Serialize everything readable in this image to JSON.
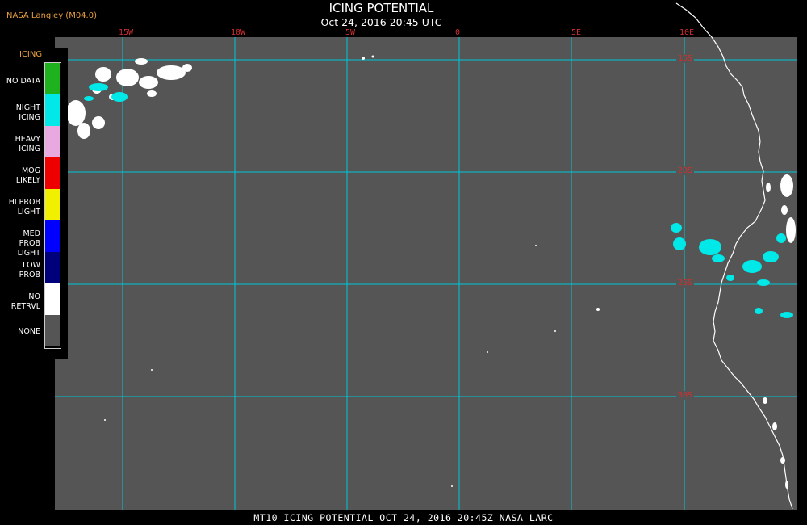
{
  "header": {
    "credit": "NASA Langley (M04.0)",
    "title": "ICING POTENTIAL",
    "timestamp": "Oct 24, 2016 20:45 UTC"
  },
  "map": {
    "background_color": "#555555",
    "grid_color": "#00c8d8",
    "coast_color": "#ffffff",
    "longitude_labels": [
      "15W",
      "10W",
      "5W",
      "0",
      "5E",
      "10E"
    ],
    "latitude_labels": [
      "15S",
      "20S",
      "25S",
      "30S"
    ]
  },
  "legend": {
    "title": "ICING",
    "items": [
      {
        "label": "NO DATA",
        "color": "#1fb21f"
      },
      {
        "label": "NIGHT ICING",
        "color": "#00e8e8"
      },
      {
        "label": "HEAVY ICING",
        "color": "#e8a8e0"
      },
      {
        "label": "MOG LIKELY",
        "color": "#ee0000"
      },
      {
        "label": "HI PROB LIGHT",
        "color": "#f0f000"
      },
      {
        "label": "MED PROB LIGHT",
        "color": "#0000ff"
      },
      {
        "label": "LOW PROB",
        "color": "#00007a"
      },
      {
        "label": "NO RETRVL",
        "color": "#ffffff"
      },
      {
        "label": "NONE",
        "color": "#555555"
      }
    ]
  },
  "footer": {
    "text": "MT10  ICING POTENTIAL   OCT 24, 2016 20:45Z   NASA LARC"
  }
}
